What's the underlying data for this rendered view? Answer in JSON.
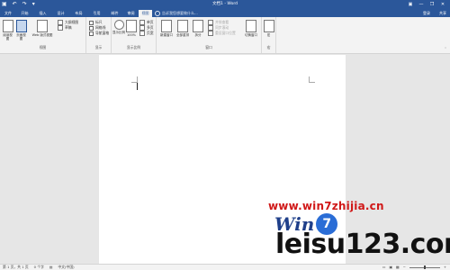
{
  "window": {
    "title": "文档1 - Word",
    "qat": [
      "save-icon",
      "undo-icon",
      "redo-icon",
      "dropdown-icon"
    ],
    "controls": {
      "ribbon_options": "▣",
      "minimize": "—",
      "restore": "❐",
      "close": "✕"
    }
  },
  "tabs": [
    {
      "label": "文件"
    },
    {
      "label": "开始"
    },
    {
      "label": "插入"
    },
    {
      "label": "设计"
    },
    {
      "label": "布局"
    },
    {
      "label": "引用"
    },
    {
      "label": "邮件"
    },
    {
      "label": "审阅"
    },
    {
      "label": "视图"
    }
  ],
  "tellme": "告诉我您想要做什么...",
  "account": "登录",
  "share": "共享",
  "ribbon": {
    "views": {
      "buttons": [
        "阅读视图",
        "页面视图",
        "Web 版式视图"
      ],
      "small": [
        "大纲视图",
        "草稿"
      ],
      "label": "视图"
    },
    "show": {
      "items": [
        "标尺",
        "网格线",
        "导航窗格"
      ],
      "label": "显示"
    },
    "zoom": {
      "buttons": [
        "显示比例",
        "100%"
      ],
      "small": [
        "单页",
        "多页",
        "页宽"
      ],
      "label": "显示比例"
    },
    "window": {
      "buttons": [
        "新建窗口",
        "全部重排",
        "拆分"
      ],
      "small": [
        "并排查看",
        "同步滚动",
        "重设窗口位置"
      ],
      "switch": "切换窗口",
      "label": "窗口"
    },
    "macros": {
      "button": "宏",
      "label": "宏"
    }
  },
  "watermark": {
    "url": "www.win7zhijia.cn",
    "logo_text": "Win",
    "logo_seven": "7",
    "site": "leisu123.com"
  },
  "status": {
    "page": "第 1 页，共 1 页",
    "words": "0 个字",
    "lang": "中文(中国)"
  }
}
